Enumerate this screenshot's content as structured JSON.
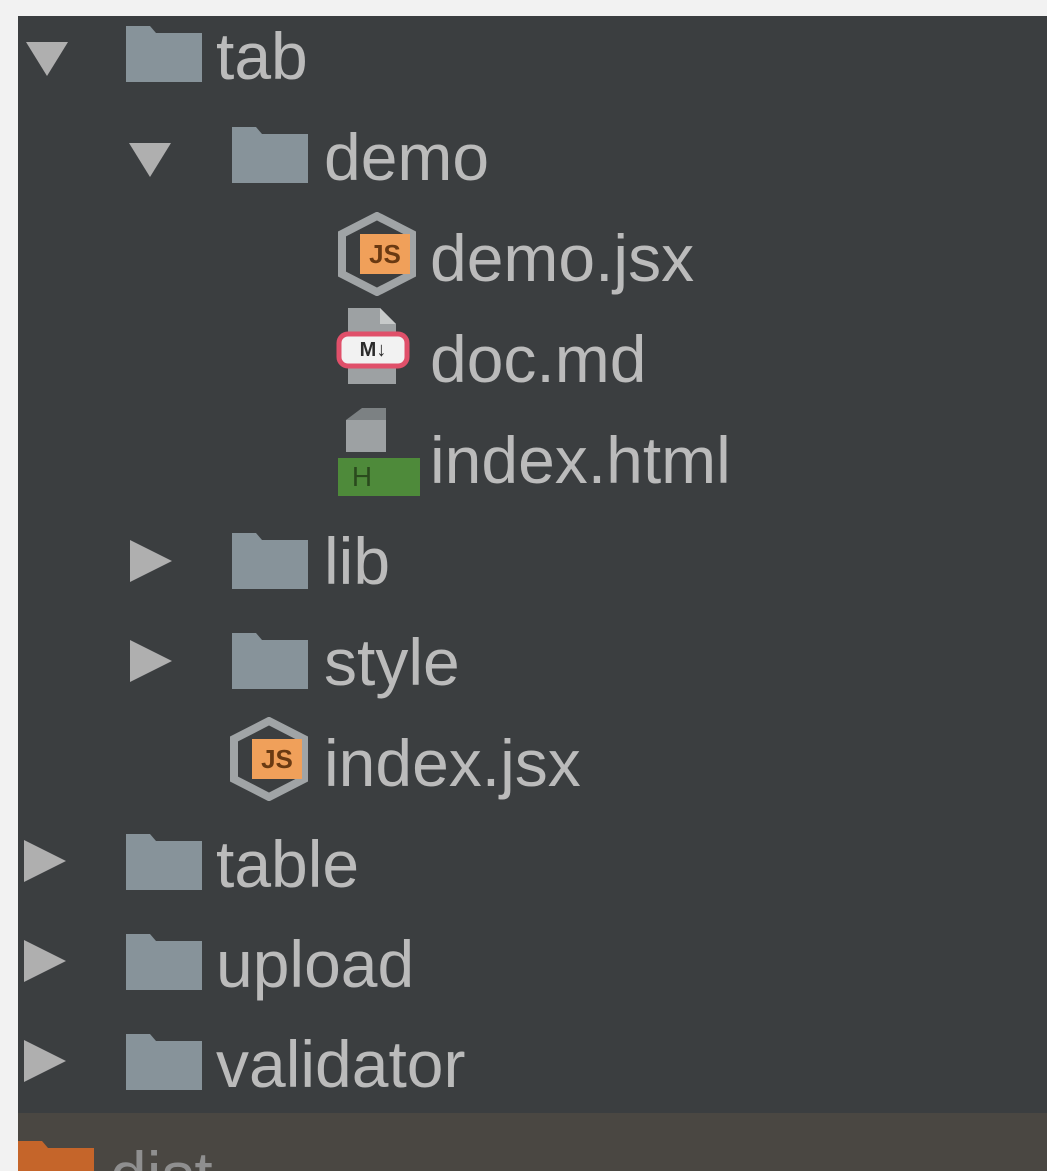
{
  "tree": {
    "tab": {
      "label": "tab"
    },
    "demo": {
      "label": "demo"
    },
    "demo_jsx": {
      "label": "demo.jsx",
      "badge": "JS"
    },
    "doc_md": {
      "label": "doc.md",
      "badge": "M↓"
    },
    "index_html": {
      "label": "index.html",
      "badge": "H"
    },
    "lib": {
      "label": "lib"
    },
    "style": {
      "label": "style"
    },
    "index_jsx": {
      "label": "index.jsx",
      "badge": "JS"
    },
    "table": {
      "label": "table"
    },
    "upload": {
      "label": "upload"
    },
    "validator": {
      "label": "validator"
    },
    "dist": {
      "label": "dist"
    }
  },
  "colors": {
    "panel_bg": "#3b3e40",
    "text": "#bbbbbb",
    "folder": "#87939a",
    "js_badge": "#f0a05a",
    "md_badge_border": "#e0506a",
    "html_badge": "#4e8a3a",
    "dist_folder": "#c5652a"
  }
}
